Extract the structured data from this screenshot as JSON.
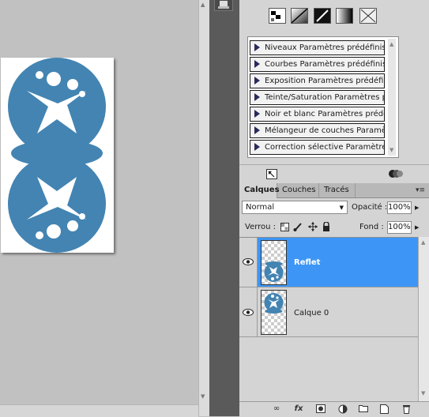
{
  "adjustments": {
    "presets": [
      "Niveaux Paramètres prédéfinis",
      "Courbes Paramètres prédéfinis",
      "Exposition Paramètres prédéfinis",
      "Teinte/Saturation Paramètres pr...",
      "Noir et blanc Paramètres prédéfi...",
      "Mélangeur de couches Paramètr...",
      "Correction sélective Paramètres ..."
    ]
  },
  "layers_panel": {
    "tabs": [
      "Calques",
      "Couches",
      "Tracés"
    ],
    "active_tab": "Calques",
    "blend_mode": "Normal",
    "opacity_label": "Opacité :",
    "opacity_value": "100%",
    "lock_label": "Verrou :",
    "fill_label": "Fond :",
    "fill_value": "100%",
    "layers": [
      {
        "name": "Reflet",
        "selected": true,
        "visible": true
      },
      {
        "name": "Calque 0",
        "selected": false,
        "visible": true
      }
    ]
  },
  "colors": {
    "artwork_blue": "#4384b2",
    "selection_blue": "#3d96f6",
    "panel_gray": "#d4d4d4",
    "canvas_gray": "#c1c1c1"
  }
}
